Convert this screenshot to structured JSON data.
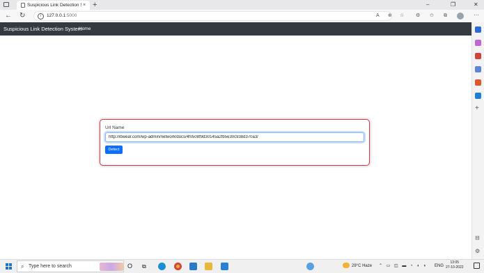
{
  "browser": {
    "tab_title": "Suspicious Link Detection System",
    "tab_close": "×",
    "new_tab": "+",
    "address_host": "127.0.0.1",
    "address_port": ":5000",
    "window_controls": {
      "minimize": "–",
      "maximize": "❐",
      "close": "✕"
    }
  },
  "navbar": {
    "brand": "Suspicious Link Detection System",
    "home": "Home"
  },
  "form": {
    "label": "Url Name",
    "url_value": "http://ibwear.com/wp-admin/network/docs/4f0508f9d30145a2fb5e30c938d370a3/",
    "submit_label": "Detect"
  },
  "taskbar": {
    "search_placeholder": "Type here to search",
    "weather": "29°C  Haze",
    "language": "ENG",
    "time": "13:05",
    "date": "27-10-2022"
  },
  "colors": {
    "navbar_bg": "#343a40",
    "card_border": "#dc3545",
    "button_bg": "#0d6efd"
  }
}
